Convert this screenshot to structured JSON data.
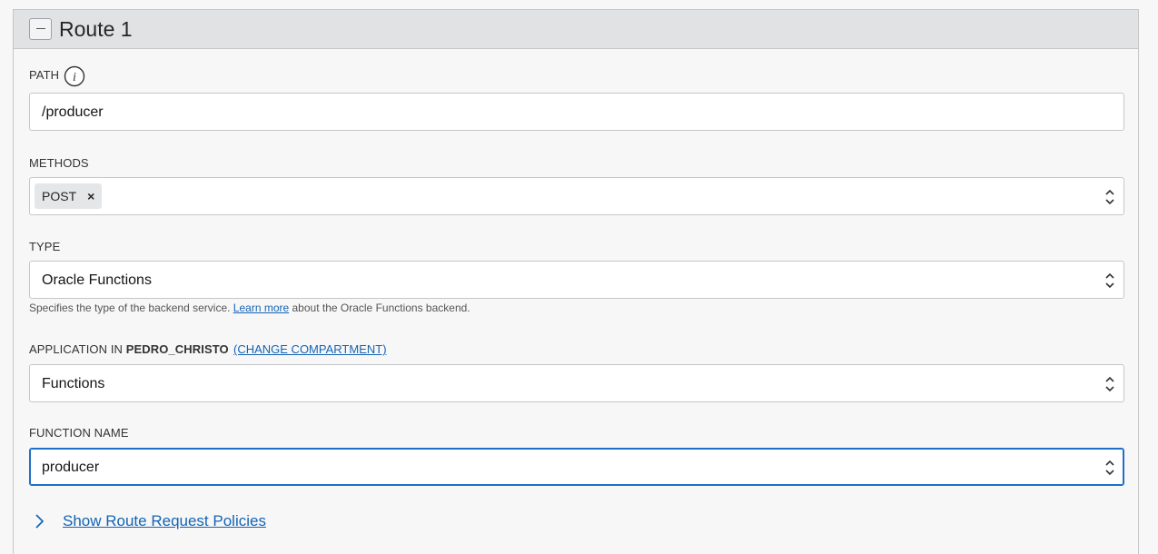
{
  "route": {
    "title": "Route 1",
    "collapse_icon": "minus-icon"
  },
  "path": {
    "label": "PATH",
    "info_icon": "info-icon",
    "value": "/producer"
  },
  "methods": {
    "label": "METHODS",
    "selected": [
      {
        "label": "POST",
        "remove": "×"
      }
    ]
  },
  "type": {
    "label": "TYPE",
    "value": "Oracle Functions",
    "help_prefix": "Specifies the type of the backend service. ",
    "help_link": "Learn more",
    "help_suffix": " about the Oracle Functions backend."
  },
  "application": {
    "label_prefix": "APPLICATION IN ",
    "compartment": "PEDRO_CHRISTO",
    "change_link": "(CHANGE COMPARTMENT)",
    "value": "Functions"
  },
  "function_name": {
    "label": "FUNCTION NAME",
    "value": "producer"
  },
  "policies": {
    "expand_icon": "chevron-right-icon",
    "link": "Show Route Request Policies"
  },
  "colors": {
    "link": "#1464b4",
    "focus": "#1e6fc8",
    "header_bg": "#e0e2e4"
  }
}
